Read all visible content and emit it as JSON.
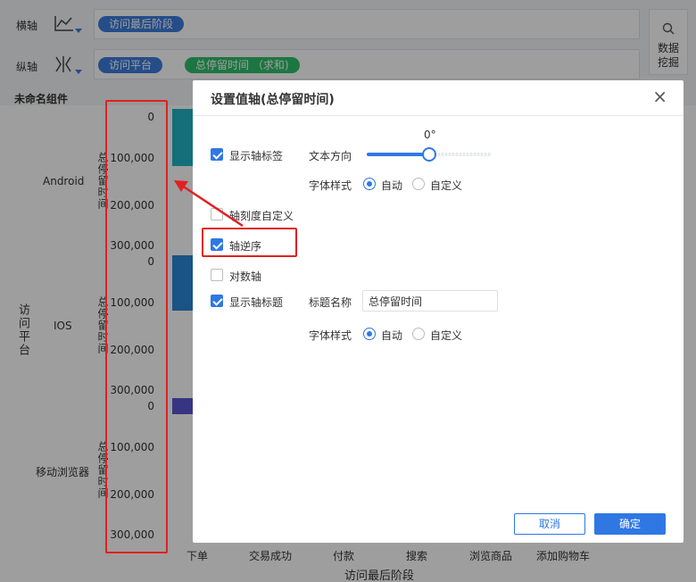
{
  "toolbar": {
    "x_axis_label": "横轴",
    "y_axis_label": "纵轴",
    "x_field": "访问最后阶段",
    "y_field_dim": "访问平台",
    "y_field_measure": "总停留时间 （求和)",
    "side_tool_line1": "数据",
    "side_tool_line2": "挖掘"
  },
  "component_title": "未命名组件",
  "chart_data": {
    "type": "bar",
    "y_dimension": "访问平台",
    "categories": [
      "Android",
      "IOS",
      "移动浏览器"
    ],
    "axis_title": "总停留时间",
    "y_ticks": [
      "0",
      "100,000",
      "200,000",
      "300,000"
    ],
    "x_categories": [
      "下单",
      "交易成功",
      "付款",
      "搜索",
      "浏览商品",
      "添加购物车"
    ],
    "x_title": "访问最后阶段",
    "colors": [
      "#1fb3c4",
      "#2a86d8",
      "#5a55d6"
    ]
  },
  "dialog": {
    "title": "设置值轴(总停留时间)",
    "show_axis_label": {
      "label": "显示轴标签",
      "checked": true
    },
    "text_direction_label": "文本方向",
    "angle_value": "0°",
    "font_style_label": "字体样式",
    "font_auto": "自动",
    "font_custom": "自定义",
    "custom_scale": {
      "label": "轴刻度自定义",
      "checked": false
    },
    "reverse_axis": {
      "label": "轴逆序",
      "checked": true
    },
    "log_axis": {
      "label": "对数轴",
      "checked": false
    },
    "show_axis_title": {
      "label": "显示轴标题",
      "checked": true
    },
    "title_name_label": "标题名称",
    "title_name_value": "总停留时间",
    "font_style_label2": "字体样式",
    "font_auto2": "自动",
    "font_custom2": "自定义",
    "cancel_label": "取消",
    "ok_label": "确定"
  },
  "colors": {
    "accent": "#2f78e4",
    "annotation": "#e02020"
  }
}
